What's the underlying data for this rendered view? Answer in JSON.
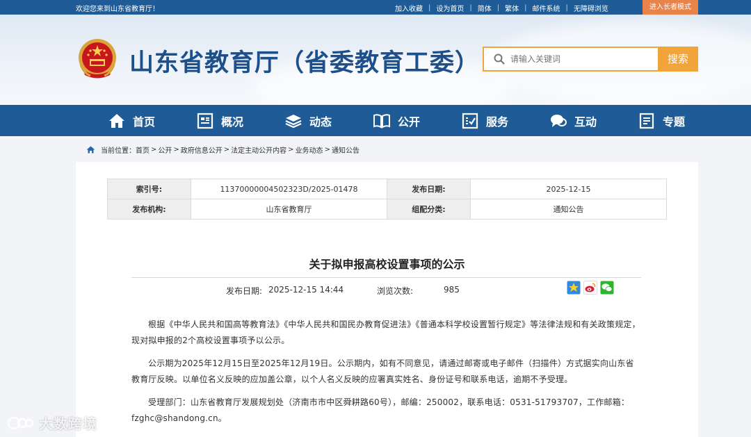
{
  "topbar": {
    "welcome": "欢迎您来到山东省教育厅！",
    "links": [
      "加入收藏",
      "设为首页",
      "简体",
      "繁体",
      "邮件系统",
      "无障碍浏览"
    ],
    "elder_mode": "进入长者模式"
  },
  "header": {
    "site_title": "山东省教育厅（省委教育工委）",
    "search_placeholder": "请输入关键词",
    "search_button": "搜索"
  },
  "nav": {
    "items": [
      {
        "label": "首页",
        "icon": "home-icon"
      },
      {
        "label": "概况",
        "icon": "overview-icon"
      },
      {
        "label": "动态",
        "icon": "news-icon"
      },
      {
        "label": "公开",
        "icon": "book-icon"
      },
      {
        "label": "服务",
        "icon": "service-icon"
      },
      {
        "label": "互动",
        "icon": "chat-icon"
      },
      {
        "label": "专题",
        "icon": "topic-icon"
      }
    ]
  },
  "breadcrumb": {
    "prefix": "当前位置：",
    "items": [
      "首页",
      "公开",
      "政府信息公开",
      "法定主动公开内容",
      "业务动态",
      "通知公告"
    ],
    "separator": ">"
  },
  "meta": {
    "index_label": "索引号:",
    "index_value": "11370000004502323D/2025-01478",
    "date_label": "发布日期:",
    "date_value": "2025-12-15",
    "org_label": "发布机构:",
    "org_value": "山东省教育厅",
    "category_label": "组配分类:",
    "category_value": "通知公告"
  },
  "article": {
    "title": "关于拟申报高校设置事项的公示",
    "publish_label": "发布日期:",
    "publish_value": "2025-12-15 14:44",
    "views_label": "浏览次数:",
    "views_value": "985",
    "paragraphs": [
      "根据《中华人民共和国高等教育法》《中华人民共和国民办教育促进法》《普通本科学校设置暂行规定》等法律法规和有关政策规定，现对拟申报的2个高校设置事项予以公示。",
      "公示期为2025年12月15日至2025年12月19日。公示期内，如有不同意见，请通过邮寄或电子邮件（扫描件）方式据实向山东省教育厅反映。以单位名义反映的应加盖公章，以个人名义反映的应署真实姓名、身份证号和联系电话，逾期不予受理。",
      "受理部门：山东省教育厅发展规划处（济南市市中区舜耕路60号），邮编：250002，联系电话：0531-51793707，工作邮箱：fzghc@shandong.cn。"
    ]
  },
  "watermark": "大数跨境",
  "colors": {
    "primary_blue": "#1f5c97",
    "accent_orange": "#f0a43a",
    "title_blue": "#1d4f8a"
  }
}
